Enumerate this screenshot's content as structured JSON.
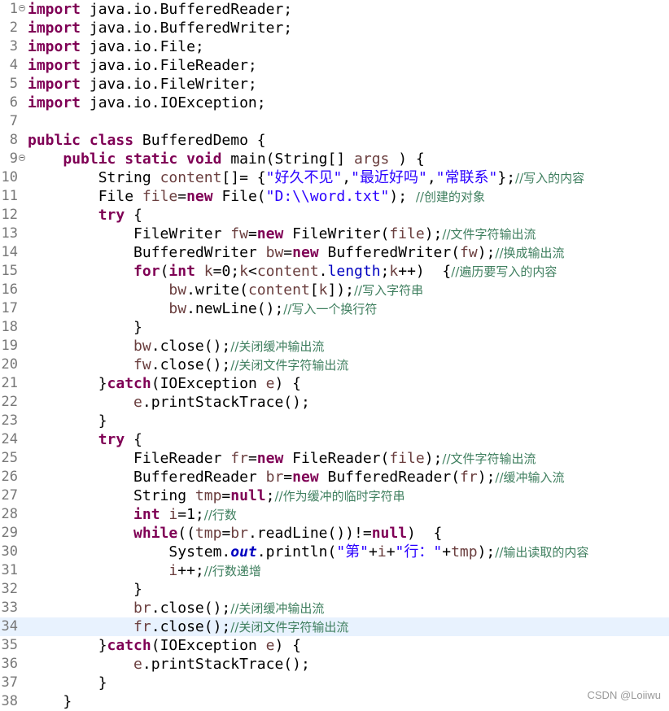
{
  "editor": {
    "language": "java",
    "current_line": 34,
    "folded_lines": [
      1,
      9
    ],
    "lines": [
      {
        "n": 1,
        "tokens": [
          [
            "kw",
            "import"
          ],
          [
            "",
            " java.io.BufferedReader;"
          ]
        ]
      },
      {
        "n": 2,
        "tokens": [
          [
            "kw",
            "import"
          ],
          [
            "",
            " java.io.BufferedWriter;"
          ]
        ]
      },
      {
        "n": 3,
        "tokens": [
          [
            "kw",
            "import"
          ],
          [
            "",
            " java.io.File;"
          ]
        ]
      },
      {
        "n": 4,
        "tokens": [
          [
            "kw",
            "import"
          ],
          [
            "",
            " java.io.FileReader;"
          ]
        ]
      },
      {
        "n": 5,
        "tokens": [
          [
            "kw",
            "import"
          ],
          [
            "",
            " java.io.FileWriter;"
          ]
        ]
      },
      {
        "n": 6,
        "tokens": [
          [
            "kw",
            "import"
          ],
          [
            "",
            " java.io.IOException;"
          ]
        ]
      },
      {
        "n": 7,
        "tokens": []
      },
      {
        "n": 8,
        "tokens": [
          [
            "kw",
            "public"
          ],
          [
            "",
            " "
          ],
          [
            "kw",
            "class"
          ],
          [
            "",
            " BufferedDemo {"
          ]
        ]
      },
      {
        "n": 9,
        "tokens": [
          [
            "",
            "    "
          ],
          [
            "kw",
            "public"
          ],
          [
            "",
            " "
          ],
          [
            "kw",
            "static"
          ],
          [
            "",
            " "
          ],
          [
            "kw",
            "void"
          ],
          [
            "",
            " main(String[] "
          ],
          [
            "var",
            "args"
          ],
          [
            "",
            " ) {"
          ]
        ]
      },
      {
        "n": 10,
        "tokens": [
          [
            "",
            "        String "
          ],
          [
            "var",
            "content"
          ],
          [
            "",
            "[]= {"
          ],
          [
            "str",
            "\"好久不见\""
          ],
          [
            "",
            ","
          ],
          [
            "str",
            "\"最近好吗\""
          ],
          [
            "",
            ","
          ],
          [
            "str",
            "\"常联系\""
          ],
          [
            "",
            "};"
          ],
          [
            "cm",
            "//写入的内容"
          ]
        ]
      },
      {
        "n": 11,
        "tokens": [
          [
            "",
            "        File "
          ],
          [
            "var",
            "file"
          ],
          [
            "",
            "="
          ],
          [
            "kw",
            "new"
          ],
          [
            "",
            " File("
          ],
          [
            "str",
            "\"D:\\\\word.txt\""
          ],
          [
            "",
            "); "
          ],
          [
            "cm",
            "//创建的对象"
          ]
        ]
      },
      {
        "n": 12,
        "tokens": [
          [
            "",
            "        "
          ],
          [
            "kw",
            "try"
          ],
          [
            "",
            " {"
          ]
        ]
      },
      {
        "n": 13,
        "tokens": [
          [
            "",
            "            FileWriter "
          ],
          [
            "var",
            "fw"
          ],
          [
            "",
            "="
          ],
          [
            "kw",
            "new"
          ],
          [
            "",
            " FileWriter("
          ],
          [
            "var",
            "file"
          ],
          [
            "",
            ");"
          ],
          [
            "cm",
            "//文件字符输出流"
          ]
        ]
      },
      {
        "n": 14,
        "tokens": [
          [
            "",
            "            BufferedWriter "
          ],
          [
            "var",
            "bw"
          ],
          [
            "",
            "="
          ],
          [
            "kw",
            "new"
          ],
          [
            "",
            " BufferedWriter("
          ],
          [
            "var",
            "fw"
          ],
          [
            "",
            ");"
          ],
          [
            "cm",
            "//换成输出流"
          ]
        ]
      },
      {
        "n": 15,
        "tokens": [
          [
            "",
            "            "
          ],
          [
            "kw",
            "for"
          ],
          [
            "",
            "("
          ],
          [
            "kw",
            "int"
          ],
          [
            "",
            " "
          ],
          [
            "var",
            "k"
          ],
          [
            "",
            "=0;"
          ],
          [
            "var",
            "k"
          ],
          [
            "",
            "<"
          ],
          [
            "var",
            "content"
          ],
          [
            "",
            "."
          ],
          [
            "fld",
            "length"
          ],
          [
            "",
            ";"
          ],
          [
            "var",
            "k"
          ],
          [
            "",
            "++)  {"
          ],
          [
            "cm",
            "//遍历要写入的内容"
          ]
        ]
      },
      {
        "n": 16,
        "tokens": [
          [
            "",
            "                "
          ],
          [
            "var",
            "bw"
          ],
          [
            "",
            ".write("
          ],
          [
            "var",
            "content"
          ],
          [
            "",
            "["
          ],
          [
            "var",
            "k"
          ],
          [
            "",
            "]);"
          ],
          [
            "cm",
            "//写入字符串"
          ]
        ]
      },
      {
        "n": 17,
        "tokens": [
          [
            "",
            "                "
          ],
          [
            "var",
            "bw"
          ],
          [
            "",
            ".newLine();"
          ],
          [
            "cm",
            "//写入一个换行符"
          ]
        ]
      },
      {
        "n": 18,
        "tokens": [
          [
            "",
            "            }"
          ]
        ]
      },
      {
        "n": 19,
        "tokens": [
          [
            "",
            "            "
          ],
          [
            "var",
            "bw"
          ],
          [
            "",
            ".close();"
          ],
          [
            "cm",
            "//关闭缓冲输出流"
          ]
        ]
      },
      {
        "n": 20,
        "tokens": [
          [
            "",
            "            "
          ],
          [
            "var",
            "fw"
          ],
          [
            "",
            ".close();"
          ],
          [
            "cm",
            "//关闭文件字符输出流"
          ]
        ]
      },
      {
        "n": 21,
        "tokens": [
          [
            "",
            "        }"
          ],
          [
            "kw",
            "catch"
          ],
          [
            "",
            "(IOException "
          ],
          [
            "var",
            "e"
          ],
          [
            "",
            ") {"
          ]
        ]
      },
      {
        "n": 22,
        "tokens": [
          [
            "",
            "            "
          ],
          [
            "var",
            "e"
          ],
          [
            "",
            ".printStackTrace();"
          ]
        ]
      },
      {
        "n": 23,
        "tokens": [
          [
            "",
            "        }"
          ]
        ]
      },
      {
        "n": 24,
        "tokens": [
          [
            "",
            "        "
          ],
          [
            "kw",
            "try"
          ],
          [
            "",
            " {"
          ]
        ]
      },
      {
        "n": 25,
        "tokens": [
          [
            "",
            "            FileReader "
          ],
          [
            "var",
            "fr"
          ],
          [
            "",
            "="
          ],
          [
            "kw",
            "new"
          ],
          [
            "",
            " FileReader("
          ],
          [
            "var",
            "file"
          ],
          [
            "",
            ");"
          ],
          [
            "cm",
            "//文件字符输出流"
          ]
        ]
      },
      {
        "n": 26,
        "tokens": [
          [
            "",
            "            BufferedReader "
          ],
          [
            "var",
            "br"
          ],
          [
            "",
            "="
          ],
          [
            "kw",
            "new"
          ],
          [
            "",
            " BufferedReader("
          ],
          [
            "var",
            "fr"
          ],
          [
            "",
            ");"
          ],
          [
            "cm",
            "//缓冲输入流"
          ]
        ]
      },
      {
        "n": 27,
        "tokens": [
          [
            "",
            "            String "
          ],
          [
            "var",
            "tmp"
          ],
          [
            "",
            "="
          ],
          [
            "kw",
            "null"
          ],
          [
            "",
            ";"
          ],
          [
            "cm",
            "//作为缓冲的临时字符串"
          ]
        ]
      },
      {
        "n": 28,
        "tokens": [
          [
            "",
            "            "
          ],
          [
            "kw",
            "int"
          ],
          [
            "",
            " "
          ],
          [
            "var",
            "i"
          ],
          [
            "",
            "=1;"
          ],
          [
            "cm",
            "//行数"
          ]
        ]
      },
      {
        "n": 29,
        "tokens": [
          [
            "",
            "            "
          ],
          [
            "kw",
            "while"
          ],
          [
            "",
            "(("
          ],
          [
            "var",
            "tmp"
          ],
          [
            "",
            "="
          ],
          [
            "var",
            "br"
          ],
          [
            "",
            ".readLine())!="
          ],
          [
            "kw",
            "null"
          ],
          [
            "",
            ")  {"
          ]
        ]
      },
      {
        "n": 30,
        "tokens": [
          [
            "",
            "                System."
          ],
          [
            "sfld",
            "out"
          ],
          [
            "",
            ".println("
          ],
          [
            "str",
            "\"第\""
          ],
          [
            "",
            "+"
          ],
          [
            "var",
            "i"
          ],
          [
            "",
            "+"
          ],
          [
            "str",
            "\"行：\""
          ],
          [
            "",
            "+"
          ],
          [
            "var",
            "tmp"
          ],
          [
            "",
            ");"
          ],
          [
            "cm",
            "//输出读取的内容"
          ]
        ]
      },
      {
        "n": 31,
        "tokens": [
          [
            "",
            "                "
          ],
          [
            "var",
            "i"
          ],
          [
            "",
            "++;"
          ],
          [
            "cm",
            "//行数递增"
          ]
        ]
      },
      {
        "n": 32,
        "tokens": [
          [
            "",
            "            }"
          ]
        ]
      },
      {
        "n": 33,
        "tokens": [
          [
            "",
            "            "
          ],
          [
            "var",
            "br"
          ],
          [
            "",
            ".close();"
          ],
          [
            "cm",
            "//关闭缓冲输出流"
          ]
        ]
      },
      {
        "n": 34,
        "tokens": [
          [
            "",
            "            "
          ],
          [
            "var",
            "fr"
          ],
          [
            "",
            ".close();"
          ],
          [
            "cm",
            "//关闭文件字符输出流"
          ]
        ]
      },
      {
        "n": 35,
        "tokens": [
          [
            "",
            "        }"
          ],
          [
            "kw",
            "catch"
          ],
          [
            "",
            "(IOException "
          ],
          [
            "var",
            "e"
          ],
          [
            "",
            ") {"
          ]
        ]
      },
      {
        "n": 36,
        "tokens": [
          [
            "",
            "            "
          ],
          [
            "var",
            "e"
          ],
          [
            "",
            ".printStackTrace();"
          ]
        ]
      },
      {
        "n": 37,
        "tokens": [
          [
            "",
            "        }"
          ]
        ]
      },
      {
        "n": 38,
        "tokens": [
          [
            "",
            "    }"
          ]
        ]
      }
    ]
  },
  "watermark": "CSDN @Loiiwu"
}
